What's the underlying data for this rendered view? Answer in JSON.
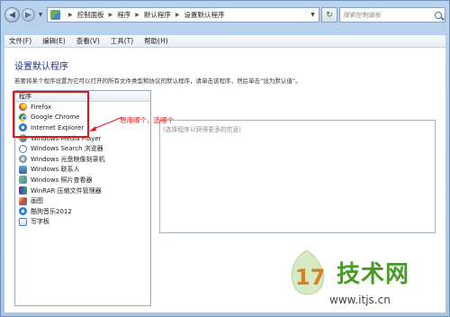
{
  "titlebar": {
    "breadcrumbs": [
      "控制面板",
      "程序",
      "默认程序",
      "设置默认程序"
    ],
    "search_placeholder": "搜索控制面板"
  },
  "menu": [
    "文件(F)",
    "编辑(E)",
    "查看(V)",
    "工具(T)",
    "帮助(H)"
  ],
  "page": {
    "title": "设置默认程序",
    "description": "若要将某个程序设置为它可以打开的所有文件类型和协议的默认程序，请单击该程序，然后单击“设为默认值”。"
  },
  "programs": {
    "header": "程序",
    "items": [
      {
        "label": "Firefox",
        "icon": "firefox-icon"
      },
      {
        "label": "Google Chrome",
        "icon": "chrome-icon"
      },
      {
        "label": "Internet Explorer",
        "icon": "internet-explorer-icon"
      },
      {
        "label": "Windows Media Player",
        "icon": "media-player-icon"
      },
      {
        "label": "Windows Search 浏览器",
        "icon": "search-explorer-icon"
      },
      {
        "label": "Windows 光盘映像刻录机",
        "icon": "disc-burner-icon"
      },
      {
        "label": "Windows 联系人",
        "icon": "contacts-icon"
      },
      {
        "label": "Windows 照片查看器",
        "icon": "photo-viewer-icon"
      },
      {
        "label": "WinRAR 压缩文件管理器",
        "icon": "winrar-icon"
      },
      {
        "label": "画图",
        "icon": "paint-icon"
      },
      {
        "label": "酷狗音乐2012",
        "icon": "kugou-icon"
      },
      {
        "label": "写字板",
        "icon": "wordpad-icon"
      }
    ]
  },
  "annotation": {
    "callout_text": "想用哪个，选哪个",
    "color": "#e01818"
  },
  "info": {
    "hint": "(选择程序以获得更多的信息)"
  },
  "watermark": {
    "brand": "技术网",
    "url": "www.itjs.cn"
  }
}
